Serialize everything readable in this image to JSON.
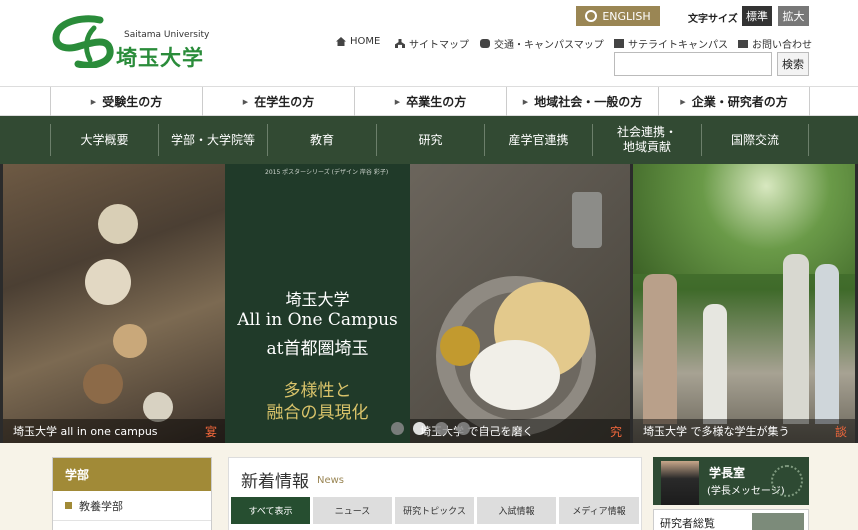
{
  "header": {
    "logo_en": "Saitama University",
    "logo_ja": "埼玉大学",
    "english_label": "ENGLISH",
    "font_size_label": "文字サイズ",
    "font_standard": "標準",
    "font_large": "拡大",
    "util_links": [
      "HOME",
      "サイトマップ",
      "交通・キャンパスマップ",
      "サテライトキャンパス",
      "お問い合わせ"
    ],
    "search_button": "検索",
    "search_value": ""
  },
  "audience_nav": [
    "受験生の方",
    "在学生の方",
    "卒業生の方",
    "地域社会・一般の方",
    "企業・研究者の方"
  ],
  "main_nav": [
    "大学概要",
    "学部・大学院等",
    "教育",
    "研究",
    "産学官連携",
    "社会連携・\n地域貢献",
    "国際交流"
  ],
  "hero": {
    "poster_top": "2015 ポスターシリーズ (デザイン 岸谷 彩子)",
    "poster_line1": "埼玉大学",
    "poster_line2": "All in One Campus",
    "poster_line3": "at首都圏埼玉",
    "poster_line4": "多様性と",
    "poster_line5": "融合の具現化",
    "caption1": "埼玉大学 all in one campus",
    "caption1_kanji": "宴",
    "caption2": "埼玉大学 で自己を磨く",
    "caption2_kanji": "究",
    "caption3": "埼玉大学 で多様な学生が集う",
    "caption3_kanji": "談"
  },
  "sidebar": {
    "heading": "学部",
    "items": [
      "教養学部"
    ]
  },
  "news": {
    "title": "新着情報",
    "subtitle": "News",
    "tabs": [
      "すべて表示",
      "ニュース",
      "研究トピックス",
      "入試情報",
      "メディア情報"
    ]
  },
  "president": {
    "line1": "学長室",
    "line2": "(学長メッセージ)"
  },
  "researcher_label": "研究者総覧",
  "colors": {
    "brand_green": "#2a8c3a",
    "nav_green": "#324a33",
    "gold": "#9a8654",
    "sidebar_gold": "#a18a37"
  }
}
